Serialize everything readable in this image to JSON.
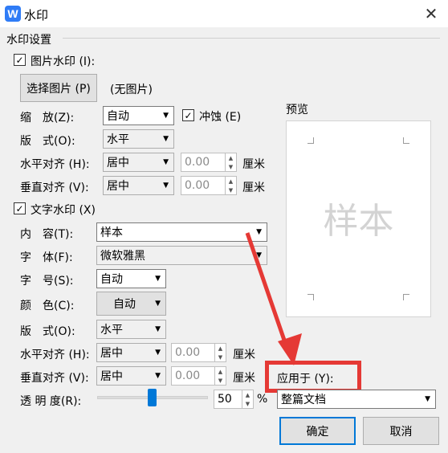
{
  "window": {
    "title": "水印",
    "app_icon": "W",
    "close_glyph": "✕"
  },
  "group_title": "水印设置",
  "picture": {
    "checkbox_label": "图片水印 (I):",
    "checked": true,
    "select_button": "选择图片 (P)",
    "no_picture": "(无图片)",
    "scale_label": "缩　放(Z):",
    "scale_value": "自动",
    "washout_label": "冲蚀 (E)",
    "washout_checked": true,
    "layout_label": "版　式(O):",
    "layout_value": "水平",
    "halign_label": "水平对齐 (H):",
    "halign_value": "居中",
    "halign_offset": "0.00",
    "valign_label": "垂直对齐 (V):",
    "valign_value": "居中",
    "valign_offset": "0.00",
    "unit": "厘米"
  },
  "text": {
    "checkbox_label": "文字水印 (X)",
    "checked": true,
    "content_label": "内　容(T):",
    "content_value": "样本",
    "font_label": "字　体(F):",
    "font_value": "微软雅黑",
    "size_label": "字　号(S):",
    "size_value": "自动",
    "color_label": "颜　色(C):",
    "color_value": "自动",
    "layout_label": "版　式(O):",
    "layout_value": "水平",
    "halign_label": "水平对齐 (H):",
    "halign_value": "居中",
    "halign_offset": "0.00",
    "valign_label": "垂直对齐 (V):",
    "valign_value": "居中",
    "valign_offset": "0.00",
    "unit": "厘米",
    "transparency_label": "透 明 度(R):",
    "transparency_value": "50",
    "transparency_unit": "%",
    "transparency_level": 0.5
  },
  "preview": {
    "label": "预览",
    "watermark_text": "样本"
  },
  "apply": {
    "label": "应用于 (Y):",
    "value": "整篇文档"
  },
  "buttons": {
    "ok": "确定",
    "cancel": "取消"
  },
  "colors": {
    "accent": "#0078d7",
    "annotation_red": "#e53935",
    "watermark_gray": "#d3d3d3"
  }
}
